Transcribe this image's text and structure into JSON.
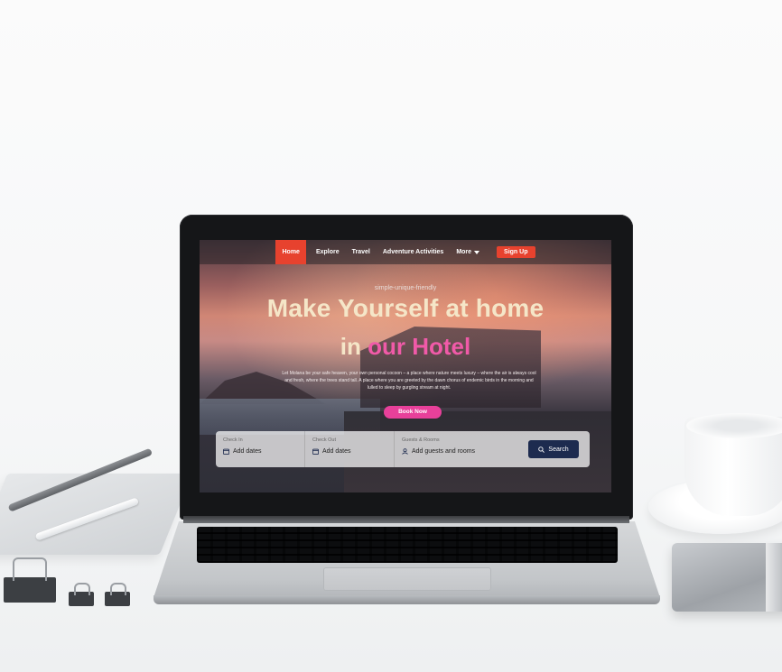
{
  "nav": {
    "items": [
      {
        "label": "Home",
        "active": true
      },
      {
        "label": "Explore",
        "active": false
      },
      {
        "label": "Travel",
        "active": false
      },
      {
        "label": "Adventure Activities",
        "active": false
      }
    ],
    "more_label": "More",
    "signup_label": "Sign Up"
  },
  "hero": {
    "tagline": "simple-unique-friendly",
    "headline": "Make Yourself at home",
    "subheadline_part1": "in ",
    "subheadline_part2": "our Hotel",
    "description": "Let Molana be your safe heaven, your own personal cocoon – a place where nature meets luxury – where the air is always cool and fresh, where the trees stand tall. A place where you are greeted by the dawn chorus of endemic birds in the morning and lulled to sleep by gurgling stream at night.",
    "cta_label": "Book Now"
  },
  "search": {
    "check_in_label": "Check In",
    "check_in_value": "Add dates",
    "check_out_label": "Check Out",
    "check_out_value": "Add dates",
    "guests_label": "Guests & Rooms",
    "guests_value": "Add guests and rooms",
    "button_label": "Search"
  },
  "colors": {
    "accent": "#e7422e",
    "pink": "#e8409a",
    "navy": "#1d2b4f",
    "headline": "#f5e6c8"
  }
}
